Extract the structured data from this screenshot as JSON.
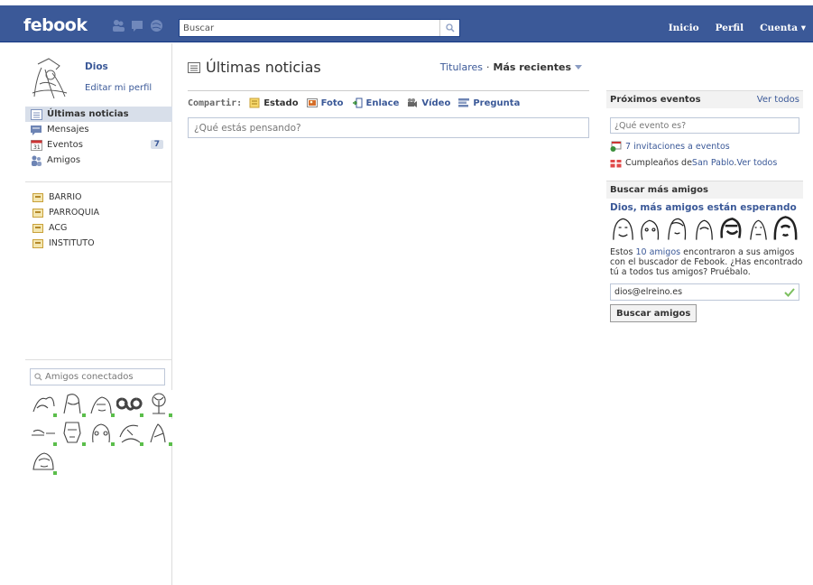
{
  "header": {
    "logo": "febook",
    "search_placeholder": "Buscar",
    "nav": [
      "Inicio",
      "Perfil",
      "Cuenta ▾"
    ]
  },
  "profile": {
    "name": "Dios",
    "edit": "Editar mi perfil"
  },
  "left_nav": [
    {
      "label": "Últimas noticias",
      "active": true
    },
    {
      "label": "Mensajes"
    },
    {
      "label": "Eventos",
      "badge": "7"
    },
    {
      "label": "Amigos"
    }
  ],
  "groups": [
    "BARRIO",
    "PARROQUIA",
    "ACG",
    "INSTITUTO"
  ],
  "chat": {
    "placeholder": "Amigos conectados",
    "online_count": 11
  },
  "feed": {
    "title": "Últimas noticias",
    "sort_link": "Titulares",
    "sort_sep": "·",
    "sort_current": "Más recientes"
  },
  "share": {
    "label": "Compartir:",
    "options": [
      "Estado",
      "Foto",
      "Enlace",
      "Vídeo",
      "Pregunta"
    ],
    "status_placeholder": "¿Qué estás pensando?"
  },
  "events": {
    "title": "Próximos eventos",
    "see_all": "Ver todos",
    "input_placeholder": "¿Qué evento es?",
    "invites": "7 invitaciones a eventos",
    "birthday_prefix": "Cumpleaños de ",
    "birthday_name": "San Pablo",
    "birthday_sep": ". ",
    "birthday_link": "Ver todos"
  },
  "find_friends": {
    "header": "Buscar más amigos",
    "title": "Dios, más amigos están esperando",
    "text_prefix": "Estos ",
    "text_link": "10 amigos",
    "text_suffix": " encontraron a sus amigos con el buscador de Febook. ¿Has encontrado tú a todos tus amigos? Pruébalo.",
    "email": "dios@elreino.es",
    "button": "Buscar amigos"
  },
  "colors": {
    "bar": "#3b5998",
    "link": "#3b5998",
    "online": "#5bbe4b"
  }
}
